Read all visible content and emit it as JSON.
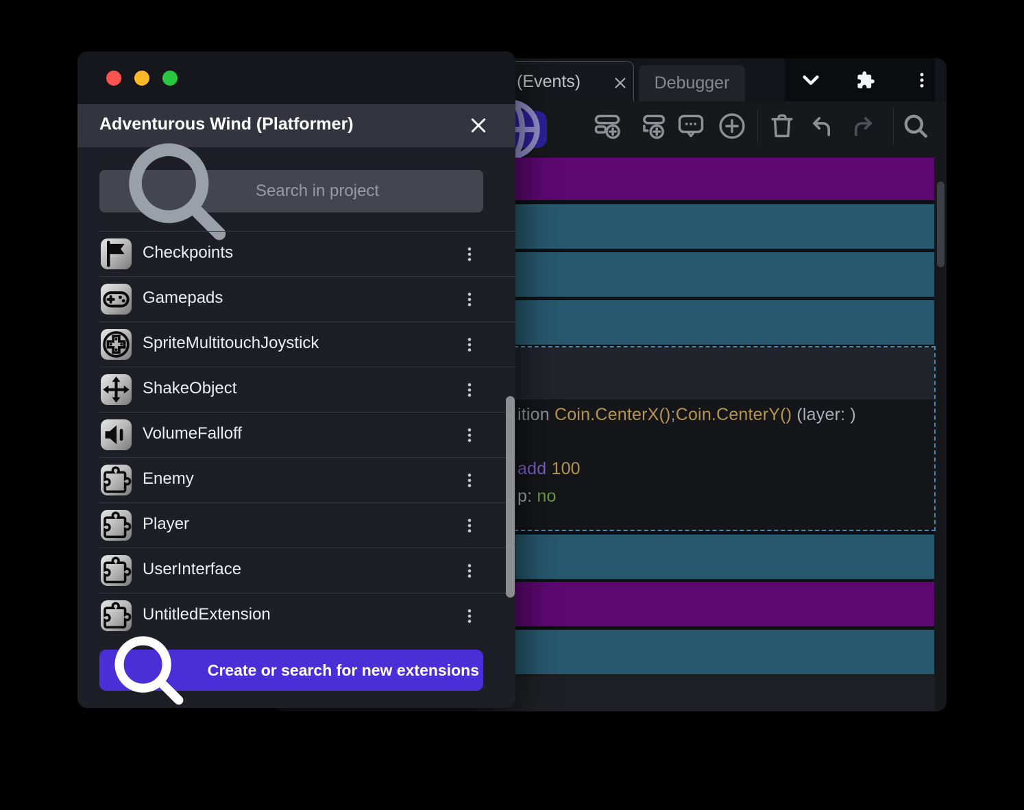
{
  "window_controls": {
    "close_color": "#f9544d",
    "minimize_color": "#fcb827",
    "zoom_color": "#28c840"
  },
  "dialog": {
    "title": "Adventurous Wind (Platformer)",
    "search_placeholder": "Search in project",
    "items": [
      {
        "label": "Checkpoints",
        "icon": "flag-icon"
      },
      {
        "label": "Gamepads",
        "icon": "gamepad-icon"
      },
      {
        "label": "SpriteMultitouchJoystick",
        "icon": "joystick-icon"
      },
      {
        "label": "ShakeObject",
        "icon": "move-icon"
      },
      {
        "label": "VolumeFalloff",
        "icon": "volume-icon"
      },
      {
        "label": "Enemy",
        "icon": "puzzle-icon"
      },
      {
        "label": "Player",
        "icon": "puzzle-icon"
      },
      {
        "label": "UserInterface",
        "icon": "puzzle-icon"
      },
      {
        "label": "UntitledExtension",
        "icon": "puzzle-icon"
      }
    ],
    "cta_label": "Create or search for new extensions",
    "accent_color": "#4a2ed6"
  },
  "editor": {
    "tabs": [
      {
        "label": "(Events)",
        "active": true,
        "closable": true
      },
      {
        "label": "Debugger",
        "active": false
      }
    ],
    "top_icons": [
      "chevron-down-icon",
      "puzzle-icon",
      "kebab-menu-icon"
    ],
    "toolbar_icons": [
      {
        "name": "add-event-icon",
        "dim": false
      },
      {
        "name": "add-subevent-icon",
        "dim": false
      },
      {
        "name": "add-comment-icon",
        "dim": false
      },
      {
        "name": "add-circle-icon",
        "dim": false
      },
      {
        "name": "trash-icon",
        "dim": false
      },
      {
        "name": "undo-icon",
        "dim": false
      },
      {
        "name": "redo-icon",
        "dim": true
      },
      {
        "name": "search-icon",
        "dim": false
      }
    ],
    "event_rows": [
      {
        "type": "purple"
      },
      {
        "type": "teal"
      },
      {
        "type": "teal"
      },
      {
        "type": "teal"
      },
      {
        "type": "selected"
      },
      {
        "type": "teal"
      },
      {
        "type": "purple"
      },
      {
        "type": "teal"
      }
    ],
    "selected_event_code": [
      [
        {
          "text": "ition ",
          "tone": "muted"
        },
        {
          "text": "Coin.CenterX()",
          "tone": "gold"
        },
        {
          "text": ";",
          "tone": "muted"
        },
        {
          "text": "Coin.CenterY()",
          "tone": "gold"
        },
        {
          "text": " ",
          "tone": "muted"
        },
        {
          "text": "(layer: )",
          "tone": "light"
        }
      ],
      [
        {
          "text": "add ",
          "tone": "purple"
        },
        {
          "text": "100",
          "tone": "gold"
        }
      ],
      [
        {
          "text": "p: ",
          "tone": "light"
        },
        {
          "text": "no",
          "tone": "green"
        }
      ]
    ],
    "colors": {
      "event_standard": "#27586d",
      "event_group": "#5c0870",
      "selection_border": "#4c86ae",
      "toolbar_accent": "#2e2098"
    }
  }
}
